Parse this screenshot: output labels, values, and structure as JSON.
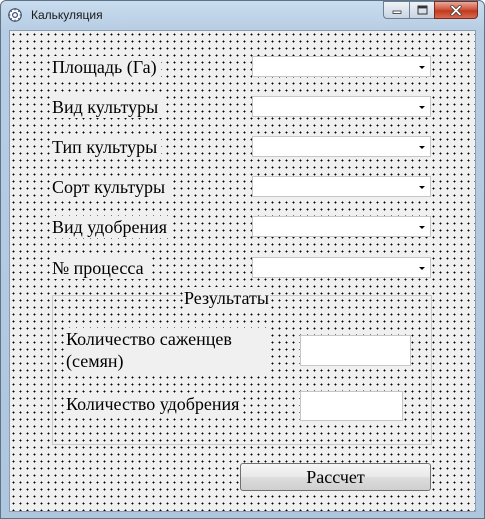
{
  "window": {
    "title": "Калькуляция",
    "icon": "app-gear-icon"
  },
  "fields": [
    {
      "label": "Площадь (Га)",
      "value": ""
    },
    {
      "label": "Вид культуры",
      "value": ""
    },
    {
      "label": "Тип культуры",
      "value": ""
    },
    {
      "label": "Сорт культуры",
      "value": ""
    },
    {
      "label": "Вид удобрения",
      "value": ""
    },
    {
      "label": "№ процесса",
      "value": ""
    }
  ],
  "results": {
    "title": "Результаты",
    "seedlings_label": "Количество саженцев (семян)",
    "seedlings_value": "",
    "fertilizer_label": "Количество удобрения",
    "fertilizer_value": ""
  },
  "calculate_button": "Рассчет",
  "colors": {
    "close_button": "#c03a1f",
    "frame": "#b7cde3",
    "client": "#f0f0f0"
  }
}
